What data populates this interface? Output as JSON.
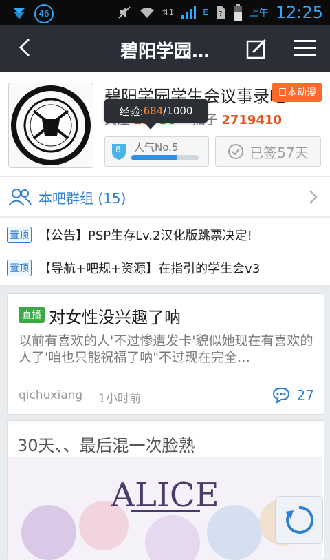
{
  "statusbar": {
    "badge": "46",
    "signal_mark": "1",
    "network": "E",
    "ampm": "上午",
    "time": "12:25"
  },
  "topbar": {
    "title": "碧阳学园…"
  },
  "forum": {
    "name": "碧阳学园学生会议事录吧",
    "category_tag": "日本动漫",
    "follow_label": "关注",
    "follow_count": "21730",
    "posts_label": "贴子",
    "posts_count": "2719410",
    "exp_label": "经验:",
    "exp_current": "684",
    "exp_total": "/1000",
    "level": "8",
    "level_name": "人气No.5",
    "level_progress": 0.684,
    "signed_label": "已签57天",
    "group_label": "本吧群组 (15)"
  },
  "pinned": [
    {
      "tag": "置顶",
      "text": "【公告】PSP生存Lv.2汉化版跳票决定!"
    },
    {
      "tag": "置顶",
      "text": "【导航+吧规+资源】在指引的学生会v3"
    }
  ],
  "posts": [
    {
      "tag": "直播",
      "title": "对女性没兴趣了呐",
      "body": "以前有喜欢的人'不过惨遭发卡'貌似她现在有喜欢的人了'咱也只能祝福了呐\"不过现在完全…",
      "author": "qichuxiang",
      "time": "1小时前",
      "replies": "27"
    },
    {
      "title": "30天、、最后混一次脸熟",
      "image_text": "ALICE"
    }
  ],
  "colors": {
    "topbar": "#2a2f37",
    "accent": "#2e7fd3",
    "orange": "#ff6a2b",
    "live": "#3aa844"
  }
}
